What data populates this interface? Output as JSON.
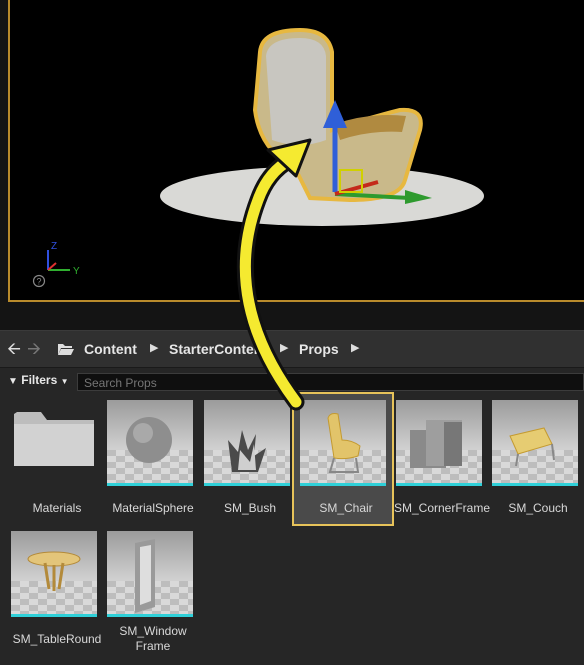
{
  "navigation": {
    "back_icon": "left-arrow-icon",
    "forward_icon": "right-arrow-icon",
    "breadcrumbs": [
      "Content",
      "StarterContent",
      "Props"
    ],
    "folder_icon": "folder-open-icon"
  },
  "filters": {
    "label": "Filters",
    "search_placeholder": "Search Props"
  },
  "viewport": {
    "axis_labels": {
      "z": "Z",
      "y": "Y"
    },
    "help_icon": "?"
  },
  "assets": [
    {
      "name": "Materials",
      "type": "folder"
    },
    {
      "name": "MaterialSphere",
      "type": "asset"
    },
    {
      "name": "SM_Bush",
      "type": "asset"
    },
    {
      "name": "SM_Chair",
      "type": "asset",
      "selected": true
    },
    {
      "name": "SM_CornerFrame",
      "type": "asset"
    },
    {
      "name": "SM_Couch",
      "type": "asset"
    },
    {
      "name": "SM_TableRound",
      "type": "asset"
    },
    {
      "name": "SM_WindowFrame",
      "label_line1": "SM_Window",
      "label_line2": "Frame",
      "type": "asset"
    }
  ],
  "colors": {
    "selection": "#e7c35a",
    "asset_bar": "#2fd0d8",
    "drag_arrow": "#f5ea30",
    "viewport_border": "#b98b2c"
  }
}
